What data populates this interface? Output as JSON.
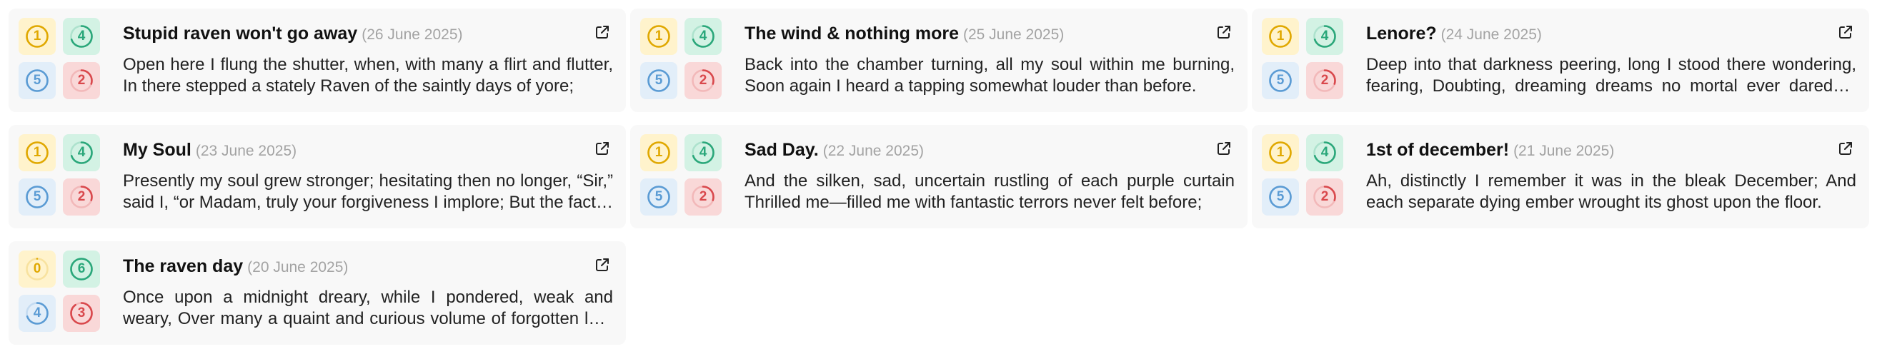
{
  "colors": {
    "card_bg": "#f8f8f8",
    "yellow": "#e0a800",
    "yellow_bg": "#fff3cc",
    "green": "#2aa77a",
    "green_bg": "#d3f2e4",
    "blue": "#5a9bd4",
    "blue_bg": "#e2eef9",
    "red": "#d9484c",
    "red_bg": "#f9d8d8"
  },
  "cards": [
    {
      "title": "Stupid raven won't go away",
      "date": "(26 June 2025)",
      "body": "Open here I flung the shutter, when, with many a flirt and flutter, In there stepped a stately Raven of the saintly days of yore;",
      "badges": [
        {
          "color": "yellow",
          "value": "1",
          "progress": 1.0
        },
        {
          "color": "green",
          "value": "4",
          "progress": 0.7
        },
        {
          "color": "blue",
          "value": "5",
          "progress": 1.0
        },
        {
          "color": "red",
          "value": "2",
          "progress": 0.3
        }
      ],
      "open_icon": "external-link-icon"
    },
    {
      "title": "The wind & nothing more",
      "date": "(25 June 2025)",
      "body": "Back into the chamber turning, all my soul within me burning, Soon again I heard a tapping somewhat louder than before.",
      "badges": [
        {
          "color": "yellow",
          "value": "1",
          "progress": 1.0
        },
        {
          "color": "green",
          "value": "4",
          "progress": 0.7
        },
        {
          "color": "blue",
          "value": "5",
          "progress": 1.0
        },
        {
          "color": "red",
          "value": "2",
          "progress": 0.3
        }
      ],
      "open_icon": "external-link-icon"
    },
    {
      "title": "Lenore?",
      "date": "(24 June 2025)",
      "body": "Deep into that darkness peering, long I stood there wondering, fearing, Doubting, dreaming dreams no mortal ever dared to dream before;",
      "badges": [
        {
          "color": "yellow",
          "value": "1",
          "progress": 1.0
        },
        {
          "color": "green",
          "value": "4",
          "progress": 0.7
        },
        {
          "color": "blue",
          "value": "5",
          "progress": 1.0
        },
        {
          "color": "red",
          "value": "2",
          "progress": 0.3
        }
      ],
      "open_icon": "external-link-icon"
    },
    {
      "title": "My Soul",
      "date": "(23 June 2025)",
      "body": "Presently my soul grew stronger; hesitating then no longer, “Sir,” said I, “or Madam, truly your forgiveness I implore; But the fact is I was napping",
      "badges": [
        {
          "color": "yellow",
          "value": "1",
          "progress": 1.0
        },
        {
          "color": "green",
          "value": "4",
          "progress": 0.7
        },
        {
          "color": "blue",
          "value": "5",
          "progress": 1.0
        },
        {
          "color": "red",
          "value": "2",
          "progress": 0.3
        }
      ],
      "open_icon": "external-link-icon"
    },
    {
      "title": "Sad Day.",
      "date": "(22 June 2025)",
      "body": "And the silken, sad, uncertain rustling of each purple curtain Thrilled me—filled me with fantastic terrors never felt before;",
      "badges": [
        {
          "color": "yellow",
          "value": "1",
          "progress": 1.0
        },
        {
          "color": "green",
          "value": "4",
          "progress": 0.7
        },
        {
          "color": "blue",
          "value": "5",
          "progress": 1.0
        },
        {
          "color": "red",
          "value": "2",
          "progress": 0.3
        }
      ],
      "open_icon": "external-link-icon"
    },
    {
      "title": "1st of december!",
      "date": "(21 June 2025)",
      "body": "Ah, distinctly I remember it was in the bleak December; And each separate dying ember wrought its ghost upon the floor.",
      "badges": [
        {
          "color": "yellow",
          "value": "1",
          "progress": 1.0
        },
        {
          "color": "green",
          "value": "4",
          "progress": 0.7
        },
        {
          "color": "blue",
          "value": "5",
          "progress": 1.0
        },
        {
          "color": "red",
          "value": "2",
          "progress": 0.3
        }
      ],
      "open_icon": "external-link-icon"
    },
    {
      "title": "The raven day",
      "date": "(20 June 2025)",
      "body": "Once upon a midnight dreary, while I pondered, weak and weary, Over many a quaint and curious volume of forgotten lore—",
      "badges": [
        {
          "color": "yellow",
          "value": "0",
          "progress": 0.0
        },
        {
          "color": "green",
          "value": "6",
          "progress": 1.0
        },
        {
          "color": "blue",
          "value": "4",
          "progress": 0.7
        },
        {
          "color": "red",
          "value": "3",
          "progress": 0.9
        }
      ],
      "open_icon": "external-link-icon"
    }
  ]
}
